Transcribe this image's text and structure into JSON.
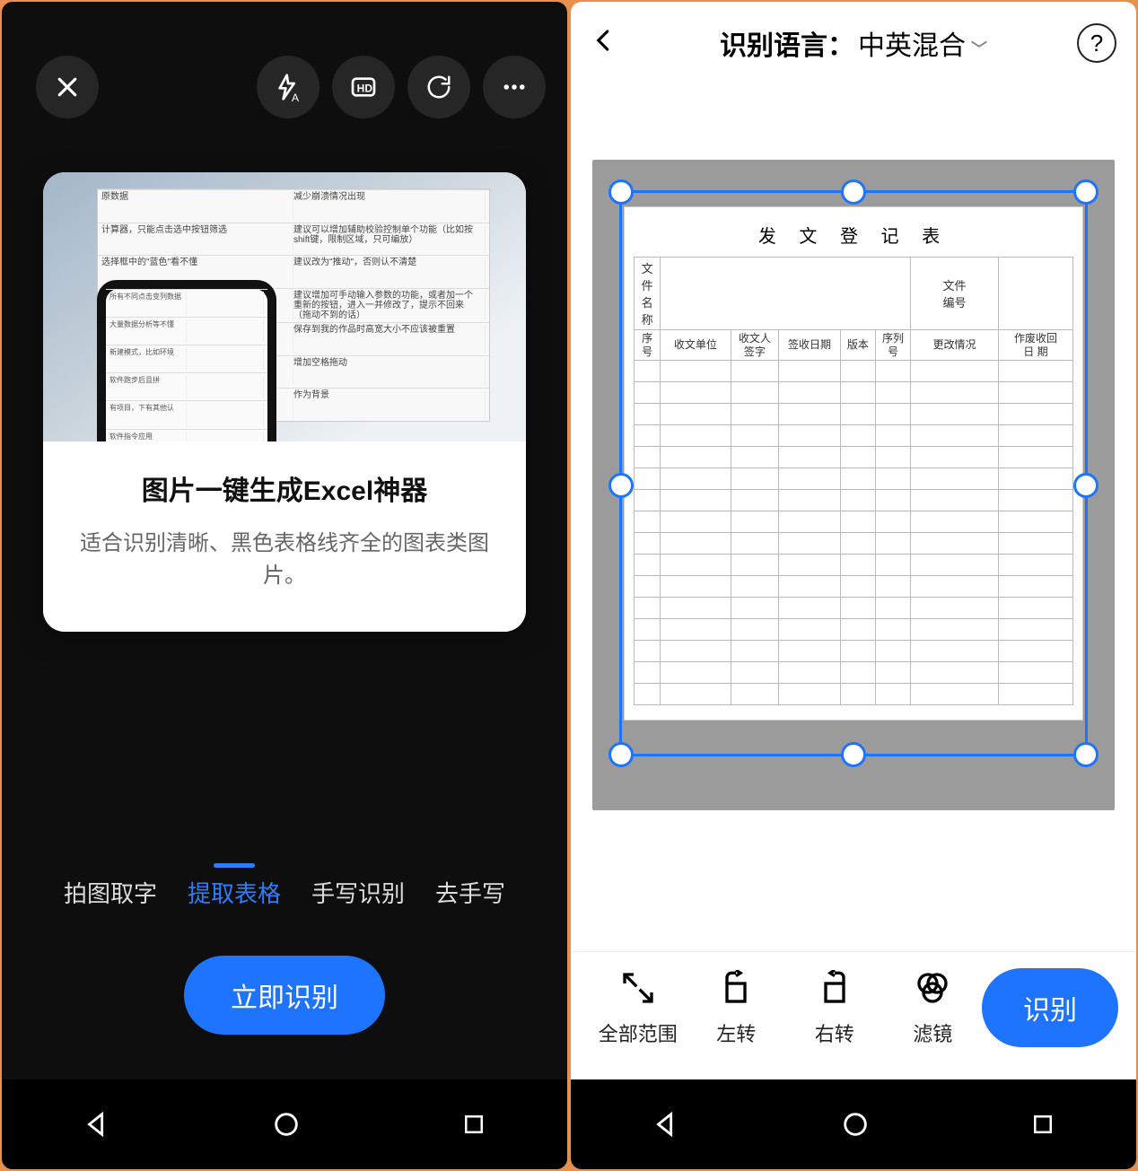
{
  "left": {
    "card": {
      "title": "图片一键生成Excel神器",
      "desc": "适合识别清晰、黑色表格线齐全的图表类图片。"
    },
    "tabs": [
      {
        "label": "拍图取字",
        "active": false
      },
      {
        "label": "提取表格",
        "active": true
      },
      {
        "label": "手写识别",
        "active": false
      },
      {
        "label": "去手写",
        "active": false
      }
    ],
    "primary_button": "立即识别"
  },
  "right": {
    "header": {
      "language_label": "识别语言：",
      "language_value": "中英混合"
    },
    "sheet": {
      "title": "发 文 登 记 表",
      "meta_labels": {
        "file_name": "文件\n名 称",
        "file_no": "文件\n编号"
      },
      "columns": [
        "序\n号",
        "收文单位",
        "收文人\n签字",
        "签收日期",
        "版本",
        "序列\n号",
        "更改情况",
        "作废收回\n日   期"
      ]
    },
    "tools": [
      {
        "label": "全部范围",
        "name": "full-range"
      },
      {
        "label": "左转",
        "name": "rotate-left"
      },
      {
        "label": "右转",
        "name": "rotate-right"
      },
      {
        "label": "滤镜",
        "name": "filter"
      }
    ],
    "primary_button": "识别"
  }
}
